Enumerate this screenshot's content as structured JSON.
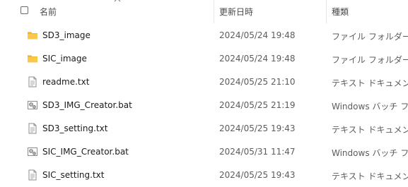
{
  "header": {
    "name_label": "名前",
    "date_label": "更新日時",
    "type_label": "種類",
    "sort_direction": "ascending"
  },
  "colors": {
    "folder": "#f8c94a",
    "folder_dark": "#e8b020",
    "separator": "#e5e5e5"
  },
  "files": [
    {
      "name": "SD3_image",
      "date": "2024/05/24 19:48",
      "type": "ファイル フォルダー",
      "icon": "folder-icon"
    },
    {
      "name": "SIC_image",
      "date": "2024/05/24 19:48",
      "type": "ファイル フォルダー",
      "icon": "folder-icon"
    },
    {
      "name": "readme.txt",
      "date": "2024/05/25 21:10",
      "type": "テキスト ドキュメント",
      "icon": "text-document-icon"
    },
    {
      "name": "SD3_IMG_Creator.bat",
      "date": "2024/05/25 21:19",
      "type": "Windows バッチ ファ",
      "icon": "batch-file-icon"
    },
    {
      "name": "SD3_setting.txt",
      "date": "2024/05/25 19:43",
      "type": "テキスト ドキュメント",
      "icon": "text-document-icon"
    },
    {
      "name": "SIC_IMG_Creator.bat",
      "date": "2024/05/31 11:47",
      "type": "Windows バッチ ファ",
      "icon": "batch-file-icon"
    },
    {
      "name": "SIC_setting.txt",
      "date": "2024/05/25 19:43",
      "type": "テキスト ドキュメント",
      "icon": "text-document-icon"
    }
  ]
}
